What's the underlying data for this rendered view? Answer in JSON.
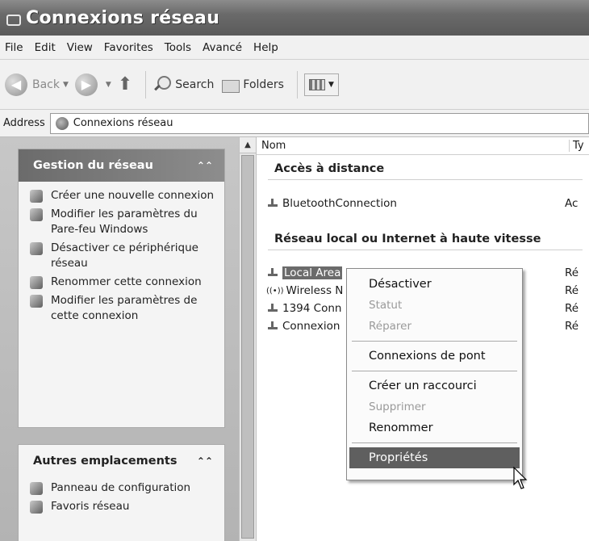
{
  "window": {
    "title": "Connexions réseau"
  },
  "menu": [
    "File",
    "Edit",
    "View",
    "Favorites",
    "Tools",
    "Avancé",
    "Help"
  ],
  "toolbar": {
    "back": "Back",
    "search": "Search",
    "folders": "Folders"
  },
  "address": {
    "label": "Address",
    "value": "Connexions réseau"
  },
  "sidebar": {
    "network_tasks": {
      "title": "Gestion du réseau",
      "items": [
        {
          "label": "Créer une nouvelle connexion",
          "icon": "new-connection-icon"
        },
        {
          "label": "Modifier les paramètres du Pare-feu Windows",
          "icon": "firewall-icon"
        },
        {
          "label": "Désactiver ce périphérique réseau",
          "icon": "disable-device-icon"
        },
        {
          "label": "Renommer cette connexion",
          "icon": "rename-icon"
        },
        {
          "label": "Modifier les paramètres de cette connexion",
          "icon": "edit-settings-icon"
        }
      ]
    },
    "other_places": {
      "title": "Autres emplacements",
      "items": [
        {
          "label": "Panneau de configuration",
          "icon": "control-panel-icon"
        },
        {
          "label": "Favoris réseau",
          "icon": "network-places-icon"
        }
      ]
    }
  },
  "list": {
    "columns": [
      "Nom",
      "Ty"
    ],
    "groups": [
      {
        "title": "Accès à distance"
      },
      {
        "title": "Réseau local ou Internet à haute vitesse"
      }
    ],
    "items": [
      {
        "name": "BluetoothConnection",
        "type": "Ac",
        "group": 0
      },
      {
        "name": "Local Area",
        "type": "Ré",
        "group": 1,
        "selected": true
      },
      {
        "name": "Wireless N",
        "type": "Ré",
        "group": 1
      },
      {
        "name": "1394 Conn",
        "type": "Ré",
        "group": 1
      },
      {
        "name": "Connexion",
        "type": "Ré",
        "group": 1
      }
    ]
  },
  "context_menu": {
    "items": [
      {
        "label": "Désactiver",
        "enabled": true
      },
      {
        "label": "Statut",
        "enabled": false
      },
      {
        "label": "Réparer",
        "enabled": false
      },
      {
        "label": "Connexions de pont",
        "enabled": true
      },
      {
        "label": "Créer un raccourci",
        "enabled": true
      },
      {
        "label": "Supprimer",
        "enabled": false
      },
      {
        "label": "Renommer",
        "enabled": true
      },
      {
        "label": "Propriétés",
        "enabled": true,
        "highlighted": true
      }
    ]
  }
}
